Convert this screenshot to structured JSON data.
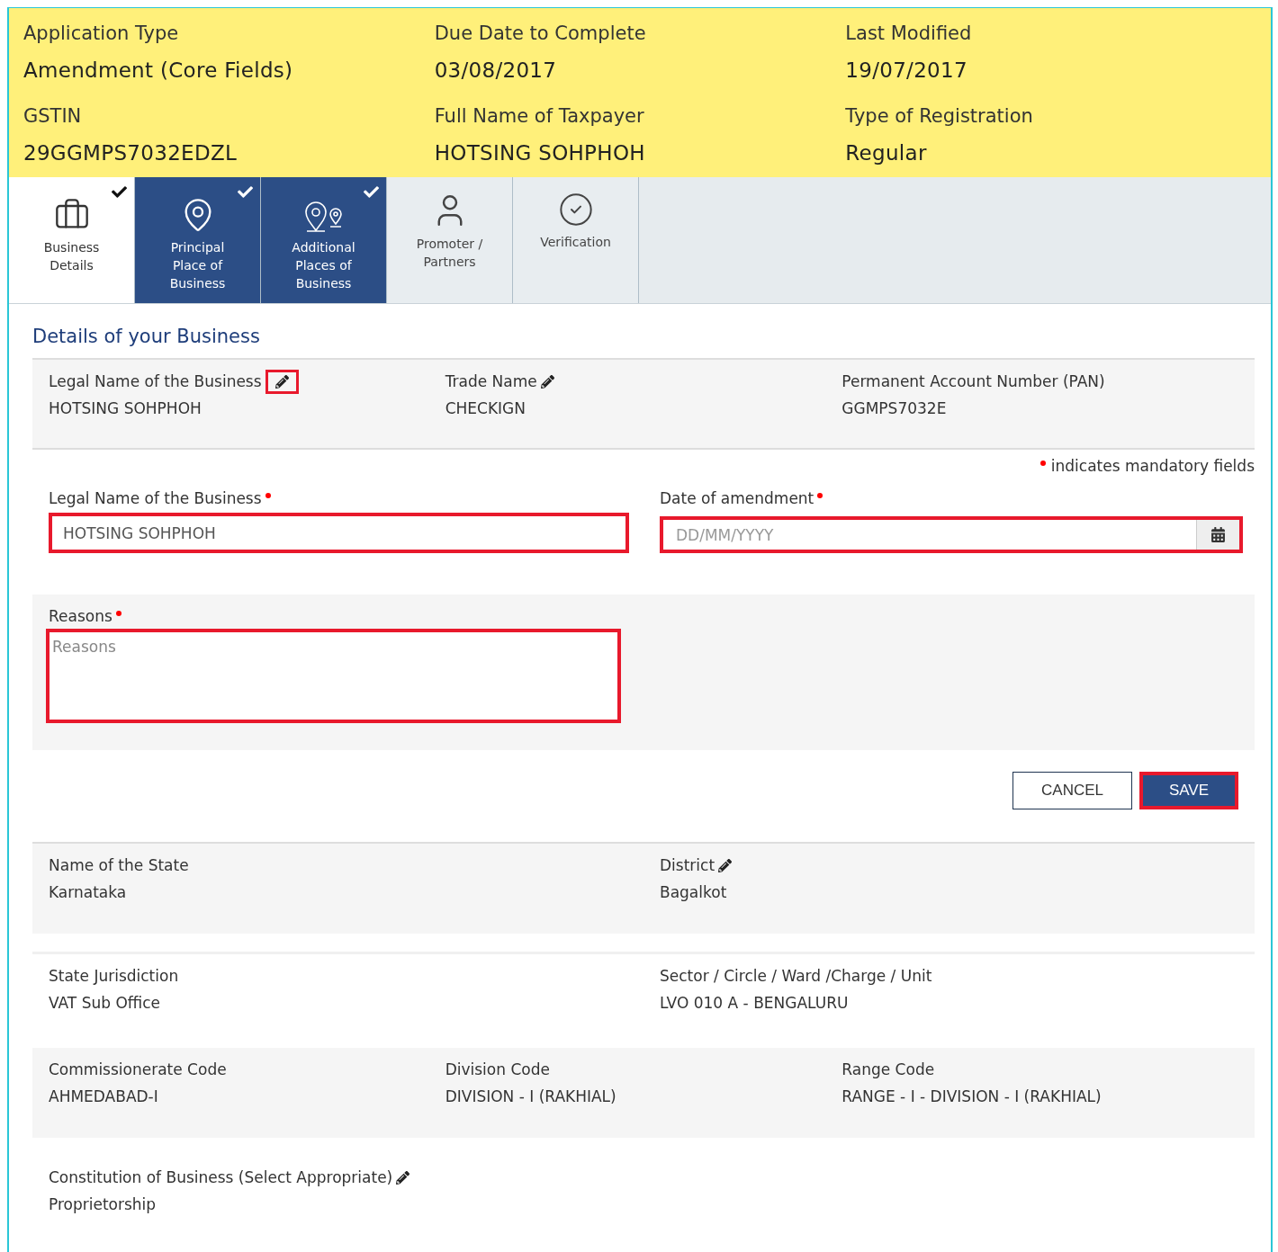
{
  "summary": [
    {
      "label": "Application Type",
      "value": "Amendment (Core Fields)"
    },
    {
      "label": "Due Date to Complete",
      "value": "03/08/2017"
    },
    {
      "label": "Last Modified",
      "value": "19/07/2017"
    },
    {
      "label": "GSTIN",
      "value": "29GGMPS7032EDZL"
    },
    {
      "label": "Full Name of Taxpayer",
      "value": "HOTSING SOHPHOH"
    },
    {
      "label": "Type of Registration",
      "value": "Regular"
    }
  ],
  "tabs": [
    {
      "label": "Business Details",
      "selected": true,
      "completed": true
    },
    {
      "label": "Principal Place of Business",
      "selected": false,
      "completed": true
    },
    {
      "label": "Additional Places of Business",
      "selected": false,
      "completed": true
    },
    {
      "label": "Promoter / Partners",
      "selected": false,
      "completed": false
    },
    {
      "label": "Verification",
      "selected": false,
      "completed": false
    }
  ],
  "heading": "Details of your Business",
  "current_details": [
    {
      "label": "Legal Name of the Business",
      "value": "HOTSING SOHPHOH",
      "editable": true,
      "highlighted": true
    },
    {
      "label": "Trade Name",
      "value": "CHECKIGN",
      "editable": true,
      "highlighted": false
    },
    {
      "label": "Permanent Account Number (PAN)",
      "value": "GGMPS7032E",
      "editable": false
    }
  ],
  "mandatory_note": "indicates mandatory fields",
  "form": {
    "legal_name": {
      "label": "Legal Name of the Business",
      "value": "HOTSING SOHPHOH",
      "required": true,
      "highlighted": true
    },
    "date": {
      "label": "Date of amendment",
      "placeholder": "DD/MM/YYYY",
      "required": true,
      "highlighted": true
    },
    "reasons": {
      "label": "Reasons",
      "placeholder": "Reasons",
      "required": true,
      "highlighted": true
    }
  },
  "buttons": [
    {
      "label": "CANCEL",
      "kind": "secondary",
      "highlighted": false
    },
    {
      "label": "SAVE",
      "kind": "primary",
      "highlighted": true
    }
  ],
  "sections": [
    {
      "items": [
        {
          "label": "Name of the State",
          "value": "Karnataka",
          "editable": false
        },
        {
          "label": "District",
          "value": "Bagalkot",
          "editable": true
        }
      ]
    },
    {
      "items": [
        {
          "label": "State Jurisdiction",
          "value": "VAT Sub Office",
          "editable": false
        },
        {
          "label": "Sector / Circle / Ward /Charge / Unit",
          "value": "LVO 010 A - BENGALURU",
          "editable": false
        }
      ]
    },
    {
      "items": [
        {
          "label": "Commissionerate Code",
          "value": "AHMEDABAD-I",
          "editable": false
        },
        {
          "label": "Division Code",
          "value": "DIVISION - I (RAKHIAL)",
          "editable": false
        },
        {
          "label": "Range Code",
          "value": "RANGE - I - DIVISION - I (RAKHIAL)",
          "editable": false
        }
      ]
    },
    {
      "items": [
        {
          "label": "Constitution of Business (Select Appropriate)",
          "value": "Proprietorship",
          "editable": true
        }
      ]
    }
  ]
}
